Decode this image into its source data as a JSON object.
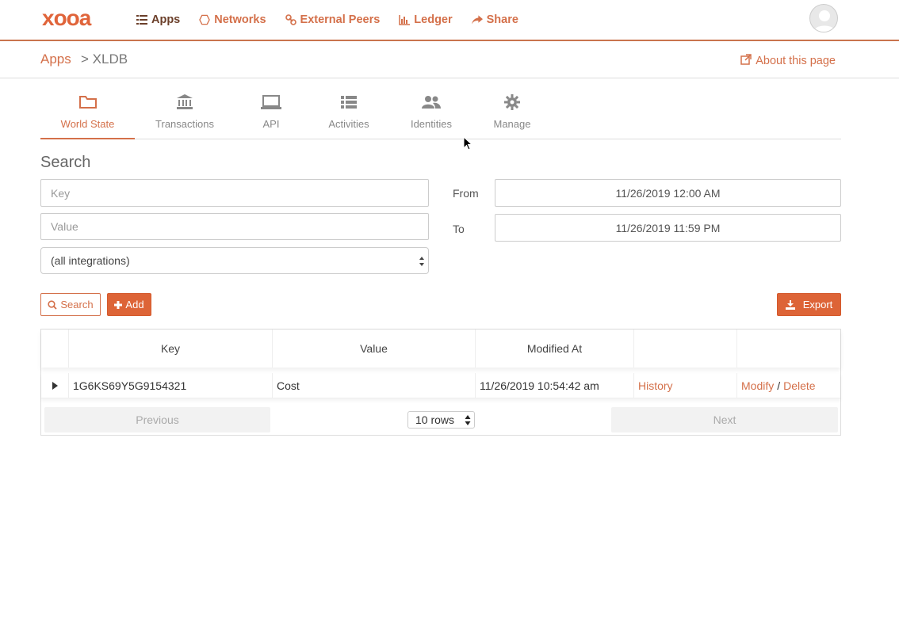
{
  "brand": {
    "logo_text": "xooa",
    "accent": "#d4704a",
    "accent_dark": "#6b3f2a",
    "button_fill": "#dd6437"
  },
  "nav": {
    "items": [
      {
        "label": "Apps",
        "icon": "list-icon"
      },
      {
        "label": "Networks",
        "icon": "hexagon-icon"
      },
      {
        "label": "External Peers",
        "icon": "link-icon"
      },
      {
        "label": "Ledger",
        "icon": "bar-chart-icon"
      },
      {
        "label": "Share",
        "icon": "share-icon"
      }
    ],
    "active": "Apps"
  },
  "breadcrumb": {
    "root": "Apps",
    "current": "> XLDB"
  },
  "about_link": "About this page",
  "tabs": [
    {
      "label": "World State",
      "icon": "folder-icon"
    },
    {
      "label": "Transactions",
      "icon": "bank-icon"
    },
    {
      "label": "API",
      "icon": "laptop-icon"
    },
    {
      "label": "Activities",
      "icon": "list-icon"
    },
    {
      "label": "Identities",
      "icon": "users-icon"
    },
    {
      "label": "Manage",
      "icon": "gear-icon"
    }
  ],
  "active_tab": "World State",
  "search": {
    "title": "Search",
    "key_placeholder": "Key",
    "value_placeholder": "Value",
    "integration_selected": "(all integrations)",
    "from_label": "From",
    "from_value": "11/26/2019 12:00 AM",
    "to_label": "To",
    "to_value": "11/26/2019 11:59 PM"
  },
  "actions": {
    "search": "Search",
    "add": "Add",
    "export": "Export"
  },
  "table": {
    "columns": [
      "Key",
      "Value",
      "Modified At",
      "",
      ""
    ],
    "rows": [
      {
        "key": "1G6KS69Y5G9154321",
        "value": "Cost",
        "modified": "11/26/2019 10:54:42 am",
        "history": "History",
        "modify": "Modify",
        "sep": "/",
        "delete": "Delete"
      }
    ],
    "previous": "Previous",
    "next": "Next",
    "page_size": "10 rows"
  }
}
